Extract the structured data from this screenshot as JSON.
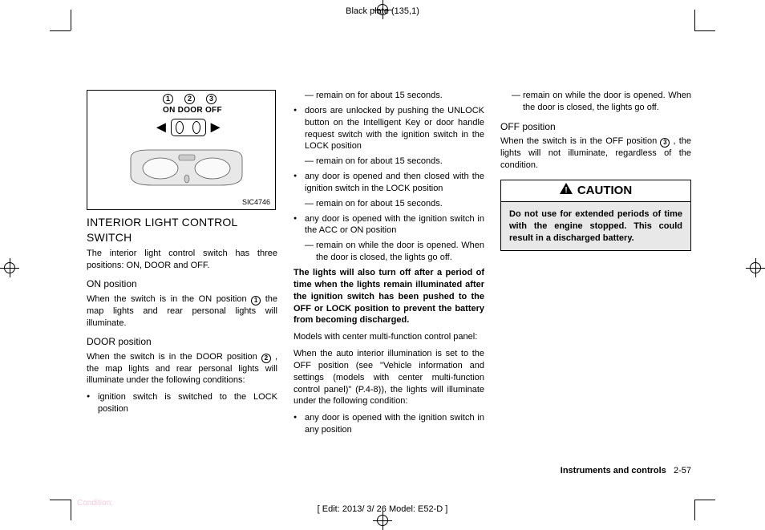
{
  "page_header": "Black plate (135,1)",
  "figure": {
    "labels_numbers": [
      "1",
      "2",
      "3"
    ],
    "labels_text": "ON  DOOR  OFF",
    "code": "SIC4746"
  },
  "col1": {
    "heading": "INTERIOR LIGHT CONTROL SWITCH",
    "p1": "The interior light control switch has three positions: ON, DOOR and OFF.",
    "h_on": "ON position",
    "p_on_a": "When the switch is in the ON position ",
    "p_on_b": " the map lights and rear personal lights will illuminate.",
    "h_door": "DOOR position",
    "p_door_a": "When the switch is in the DOOR position ",
    "p_door_b": " , the map lights and rear personal lights will illuminate under the following conditions:",
    "li1": "ignition switch is switched to the LOCK position"
  },
  "col2": {
    "d1": "remain on for about 15 seconds.",
    "li2": "doors are unlocked by pushing the UNLOCK button on the Intelligent Key or door handle request switch with the ignition switch in the LOCK position",
    "d2": "remain on for about 15 seconds.",
    "li3": "any door is opened and then closed with the ignition switch in the LOCK position",
    "d3": "remain on for about 15 seconds.",
    "li4": "any door is opened with the ignition switch in the ACC or ON position",
    "d4": "remain on while the door is opened. When the door is closed, the lights go off.",
    "bold_p": "The lights will also turn off after a period of time when the lights remain illuminated after the ignition switch has been pushed to the OFF or LOCK position to prevent the battery from becoming discharged.",
    "p_models": "Models with center multi-function control panel:",
    "p_auto": "When the auto interior illumination is set to the OFF position (see \"Vehicle information and settings (models with center multi-function control panel)\" (P.4-8)), the lights will illuminate under the following condition:",
    "li5": "any door is opened with the ignition switch in any position"
  },
  "col3": {
    "d5": "remain on while the door is opened. When the door is closed, the lights go off.",
    "h_off": "OFF position",
    "p_off_a": "When the switch is in the OFF position ",
    "p_off_b": " , the lights will not illuminate, regardless of the condition.",
    "caution_title": "CAUTION",
    "caution_body": "Do not use for extended periods of time with the engine stopped. This could result in a discharged battery."
  },
  "footer": {
    "section_label": "Instruments and controls",
    "section_page": "2-57",
    "edit": "[ Edit: 2013/ 3/ 26  Model: E52-D ]",
    "condition": "Condition:"
  },
  "circ": {
    "one": "1",
    "two": "2",
    "three": "3"
  }
}
